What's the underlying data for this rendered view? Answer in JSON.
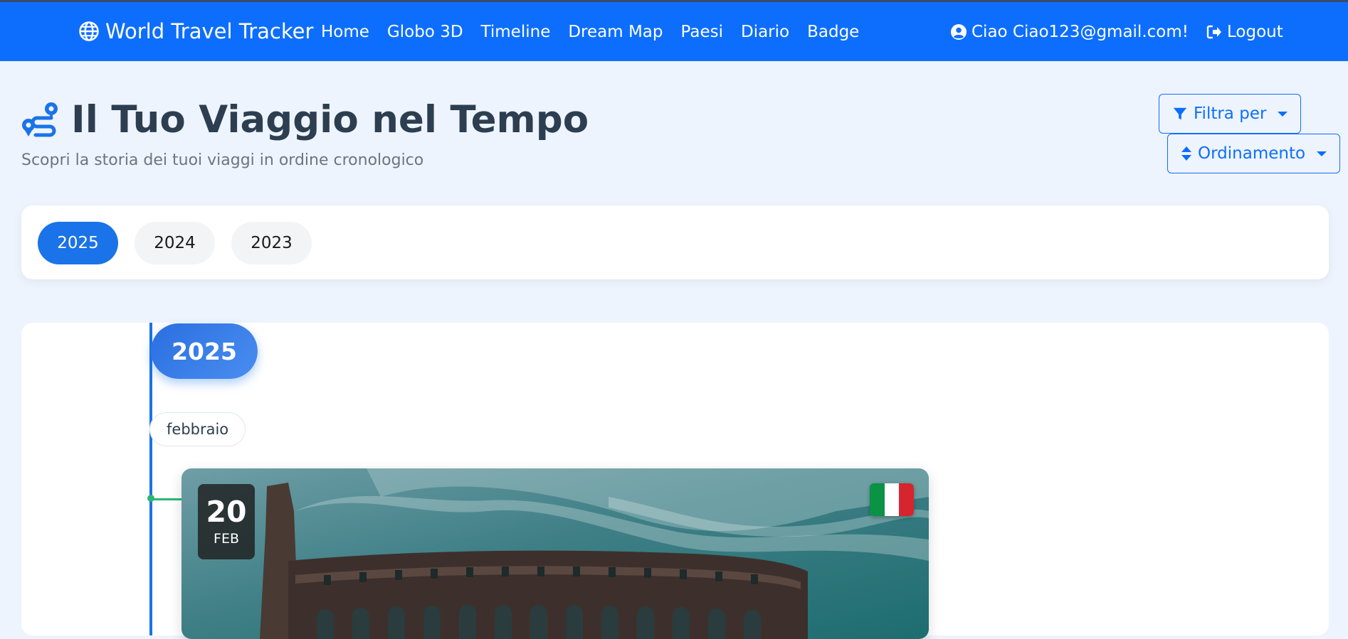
{
  "navbar": {
    "brand": "World Travel Tracker",
    "links": [
      "Home",
      "Globo 3D",
      "Timeline",
      "Dream Map",
      "Paesi",
      "Diario",
      "Badge"
    ],
    "greeting": "Ciao Ciao123@gmail.com!",
    "logout": "Logout"
  },
  "header": {
    "title": "Il Tuo Viaggio nel Tempo",
    "subtitle": "Scopri la storia dei tuoi viaggi in ordine cronologico",
    "filter_label": "Filtra per",
    "sort_label": "Ordinamento"
  },
  "year_filter": {
    "years": [
      "2025",
      "2024",
      "2023"
    ],
    "active": "2025"
  },
  "timeline": {
    "year": "2025",
    "month": "febbraio",
    "entries": [
      {
        "day": "20",
        "month_short": "FEB",
        "country_flag": "italy-flag"
      }
    ]
  },
  "colors": {
    "primary": "#0d6efd",
    "accent": "#1a73e8",
    "background": "#eef4fd",
    "connector": "#2bb673"
  }
}
